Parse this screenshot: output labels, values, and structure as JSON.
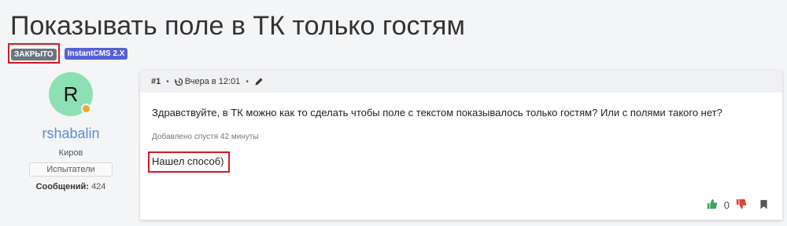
{
  "page": {
    "title": "Показывать поле в ТК только гостям"
  },
  "badges": {
    "closed": "ЗАКРЫТО",
    "cms": "InstantCMS 2.X"
  },
  "author": {
    "initial": "R",
    "name": "rshabalin",
    "city": "Киров",
    "group": "Испытатели",
    "messages_label": "Сообщений:",
    "messages_count": "424"
  },
  "post": {
    "number": "#1",
    "date": "Вчера в 12:01",
    "text": "Здравствуйте, в ТК можно как то сделать чтобы поле с текстом показывалось только гостям? Или с полями такого нет?",
    "added_note": "Добавлено спустя 42 минуты",
    "addition": "Нашел способ)",
    "rating": "0"
  },
  "colors": {
    "accent": "#5a8ed8",
    "highlight": "#d4191f",
    "avatar": "#8ce0b3"
  },
  "icons": {
    "history": "history-icon",
    "edit": "pencil-icon",
    "like": "thumbs-up-icon",
    "dislike": "thumbs-down-icon",
    "bookmark": "bookmark-icon"
  }
}
